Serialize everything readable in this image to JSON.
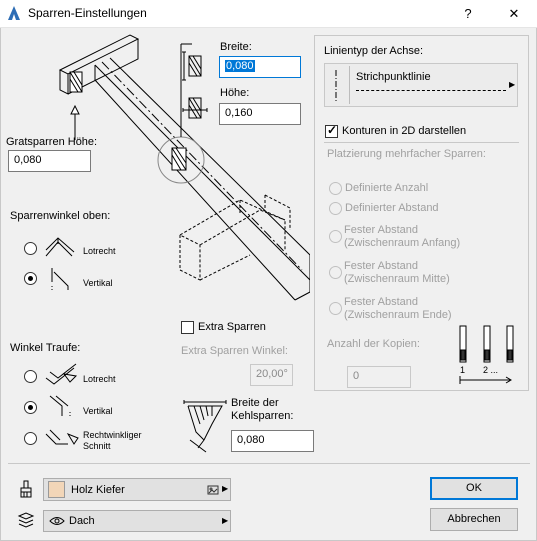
{
  "window": {
    "title": "Sparren-Einstellungen",
    "help_label": "?",
    "close_label": "✕"
  },
  "size": {
    "width_label": "Breite:",
    "width_value": "0,080",
    "height_label": "Höhe:",
    "height_value": "0,160"
  },
  "grat": {
    "label": "Gratsparren Höhe:",
    "value": "0,080"
  },
  "rafter_angle_top": {
    "label": "Sparrenwinkel oben:",
    "options": [
      {
        "label": "Lotrecht",
        "checked": false
      },
      {
        "label": "Vertikal",
        "checked": true
      }
    ]
  },
  "eave_angle": {
    "label": "Winkel Traufe:",
    "options": [
      {
        "label": "Lotrecht",
        "checked": false
      },
      {
        "label": "Vertikal",
        "checked": true
      },
      {
        "label": "Rechtwinkliger Schnitt",
        "checked": false
      }
    ]
  },
  "extra": {
    "checkbox_label": "Extra Sparren",
    "checked": false,
    "angle_label": "Extra Sparren Winkel:",
    "angle_value": "20,00°"
  },
  "valley": {
    "label": "Breite der Kehlsparren:",
    "value": "0,080"
  },
  "axis": {
    "linetype_label": "Linientyp der Achse:",
    "linetype_value": "Strichpunktlinie",
    "contours_label": "Konturen in 2D darstellen",
    "contours_checked": true
  },
  "placement": {
    "title": "Platzierung mehrfacher Sparren:",
    "options": [
      "Definierte Anzahl",
      "Definierter Abstand",
      "Fester Abstand (Zwischenraum Anfang)",
      "Fester Abstand (Zwischenraum Mitte)",
      "Fester Abstand (Zwischenraum Ende)"
    ],
    "copies_label": "Anzahl der Kopien:",
    "copies_value": "0",
    "index_first": "1",
    "index_second": "2 ..."
  },
  "material": {
    "label": "Holz Kiefer",
    "swatch_color": "#f2d6b8"
  },
  "layer": {
    "label": "Dach"
  },
  "buttons": {
    "ok": "OK",
    "cancel": "Abbrechen"
  },
  "colors": {
    "accent": "#0078d7",
    "dialog_bg": "#f0f0f0"
  }
}
